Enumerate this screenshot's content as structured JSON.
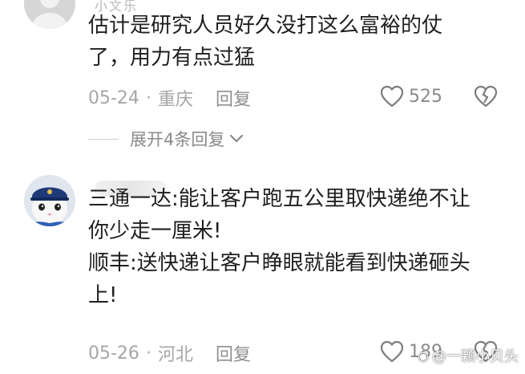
{
  "comments": [
    {
      "username": "小文乐",
      "text_lines": [
        "估计是研究人员好久没打这么富裕的仗",
        "了，用力有点过猛"
      ],
      "date": "05-24",
      "separator": "·",
      "location": "重庆",
      "reply_label": "回复",
      "likes": "525",
      "expand_label": "展开4条回复"
    },
    {
      "username": "",
      "text_lines": [
        "三通一达:能让客户跑五公里取快递绝不让",
        "你少走一厘米!",
        "顺丰:送快递让客户睁眼就能看到快递砸头",
        "上!"
      ],
      "date": "05-26",
      "separator": "·",
      "location": "河北",
      "reply_label": "回复",
      "likes": "189"
    }
  ],
  "watermark": "@一颗小贝头",
  "colors": {
    "text": "#1f1f1f",
    "meta": "#a6a6a6",
    "icon": "#8a8a8a"
  },
  "icons": [
    "heart-outline-icon",
    "broken-heart-icon",
    "chevron-down-icon",
    "weibo-logo-icon"
  ]
}
